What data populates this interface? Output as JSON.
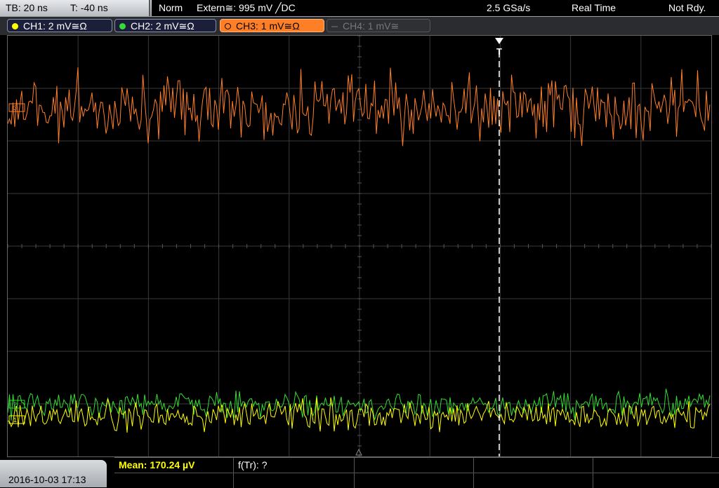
{
  "topbar": {
    "timebase": "TB: 20 ns",
    "trigger_offset": "T: -40 ns",
    "trigger_mode": "Norm",
    "trigger_source": "Extern≅: 995 mV ╱DC",
    "sample_rate": "2.5 GSa/s",
    "acq_mode": "Real Time",
    "run_status": "Not Rdy."
  },
  "channels": [
    {
      "label": "CH1: 2 mV≅Ω",
      "color": "#ffff00",
      "active": true
    },
    {
      "label": "CH2: 2 mV≅Ω",
      "color": "#33dd33",
      "active": true
    },
    {
      "label": "CH3: 1 mV≅Ω",
      "color": "#ff7f27",
      "active": true,
      "selected": true
    },
    {
      "label": "CH4: 1 mV≅",
      "color": "#666666",
      "active": false
    }
  ],
  "trace_markers": {
    "ch1": "1",
    "ch2": "2",
    "ch3": "3"
  },
  "trigger_marker": "T",
  "bottombar": {
    "datetime": "2016-10-03 17:13",
    "measurement_1": "Mean: 170.24 µV",
    "measurement_2": "f(Tr): ?"
  },
  "colors": {
    "ch1": "#ffff00",
    "ch2": "#33dd33",
    "ch3": "#ff7f27",
    "grid": "#3a3a3a",
    "measurement_text": "#ffff00"
  }
}
